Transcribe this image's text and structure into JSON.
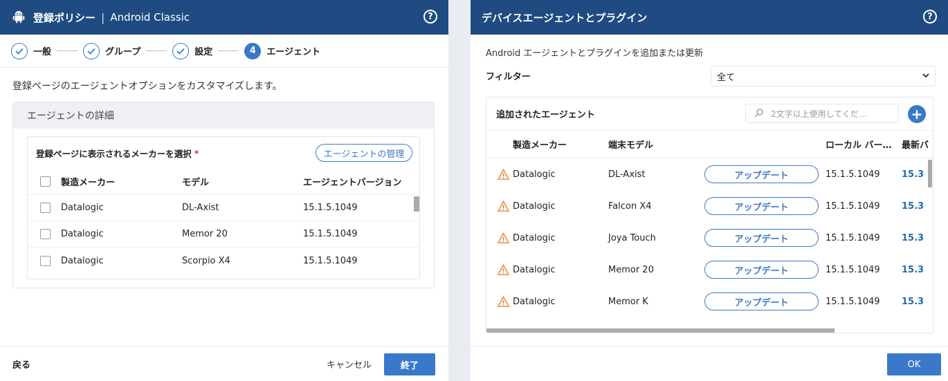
{
  "left": {
    "title": "登録ポリシー",
    "title_sep": "|",
    "subtitle": "Android Classic",
    "help": "?",
    "steps": [
      {
        "label": "一般",
        "state": "done"
      },
      {
        "label": "グループ",
        "state": "done"
      },
      {
        "label": "設定",
        "state": "done"
      },
      {
        "label": "エージェント",
        "state": "active",
        "number": "4"
      }
    ],
    "description": "登録ページのエージェントオプションをカスタマイズします。",
    "card_title": "エージェントの詳細",
    "select_label": "登録ページに表示されるメーカーを選択",
    "required_mark": "*",
    "manage_button": "エージェントの管理",
    "columns": [
      "製造メーカー",
      "モデル",
      "エージェントバージョン"
    ],
    "rows": [
      {
        "maker": "Datalogic",
        "model": "DL-Axist",
        "version": "15.1.5.1049"
      },
      {
        "maker": "Datalogic",
        "model": "Memor 20",
        "version": "15.1.5.1049"
      },
      {
        "maker": "Datalogic",
        "model": "Scorpio X4",
        "version": "15.1.5.1049"
      }
    ],
    "footer": {
      "back": "戻る",
      "cancel": "キャンセル",
      "finish": "終了"
    }
  },
  "right": {
    "title": "デバイスエージェントとプラグイン",
    "help": "?",
    "description": "Android エージェントとプラグインを追加または更新",
    "filter_label": "フィルター",
    "filter_value": "全て",
    "card_title": "追加されたエージェント",
    "search_placeholder": "2文字以上使用してくだ…",
    "add": "+",
    "columns": [
      "製造メーカー",
      "端末モデル",
      "ローカル バー…",
      "最新バ"
    ],
    "rows": [
      {
        "maker": "Datalogic",
        "model": "DL-Axist",
        "action": "アップデート",
        "local": "15.1.5.1049",
        "latest": "15.3"
      },
      {
        "maker": "Datalogic",
        "model": "Falcon X4",
        "action": "アップデート",
        "local": "15.1.5.1049",
        "latest": "15.3"
      },
      {
        "maker": "Datalogic",
        "model": "Joya Touch",
        "action": "アップデート",
        "local": "15.1.5.1049",
        "latest": "15.3"
      },
      {
        "maker": "Datalogic",
        "model": "Memor 20",
        "action": "アップデート",
        "local": "15.1.5.1049",
        "latest": "15.3"
      },
      {
        "maker": "Datalogic",
        "model": "Memor K",
        "action": "アップデート",
        "local": "15.1.5.1049",
        "latest": "15.3"
      }
    ],
    "ok": "OK"
  },
  "colors": {
    "header": "#1f4b82",
    "accent": "#3a78c9",
    "warning": "#e07b1f",
    "link": "#1f6ab5"
  }
}
